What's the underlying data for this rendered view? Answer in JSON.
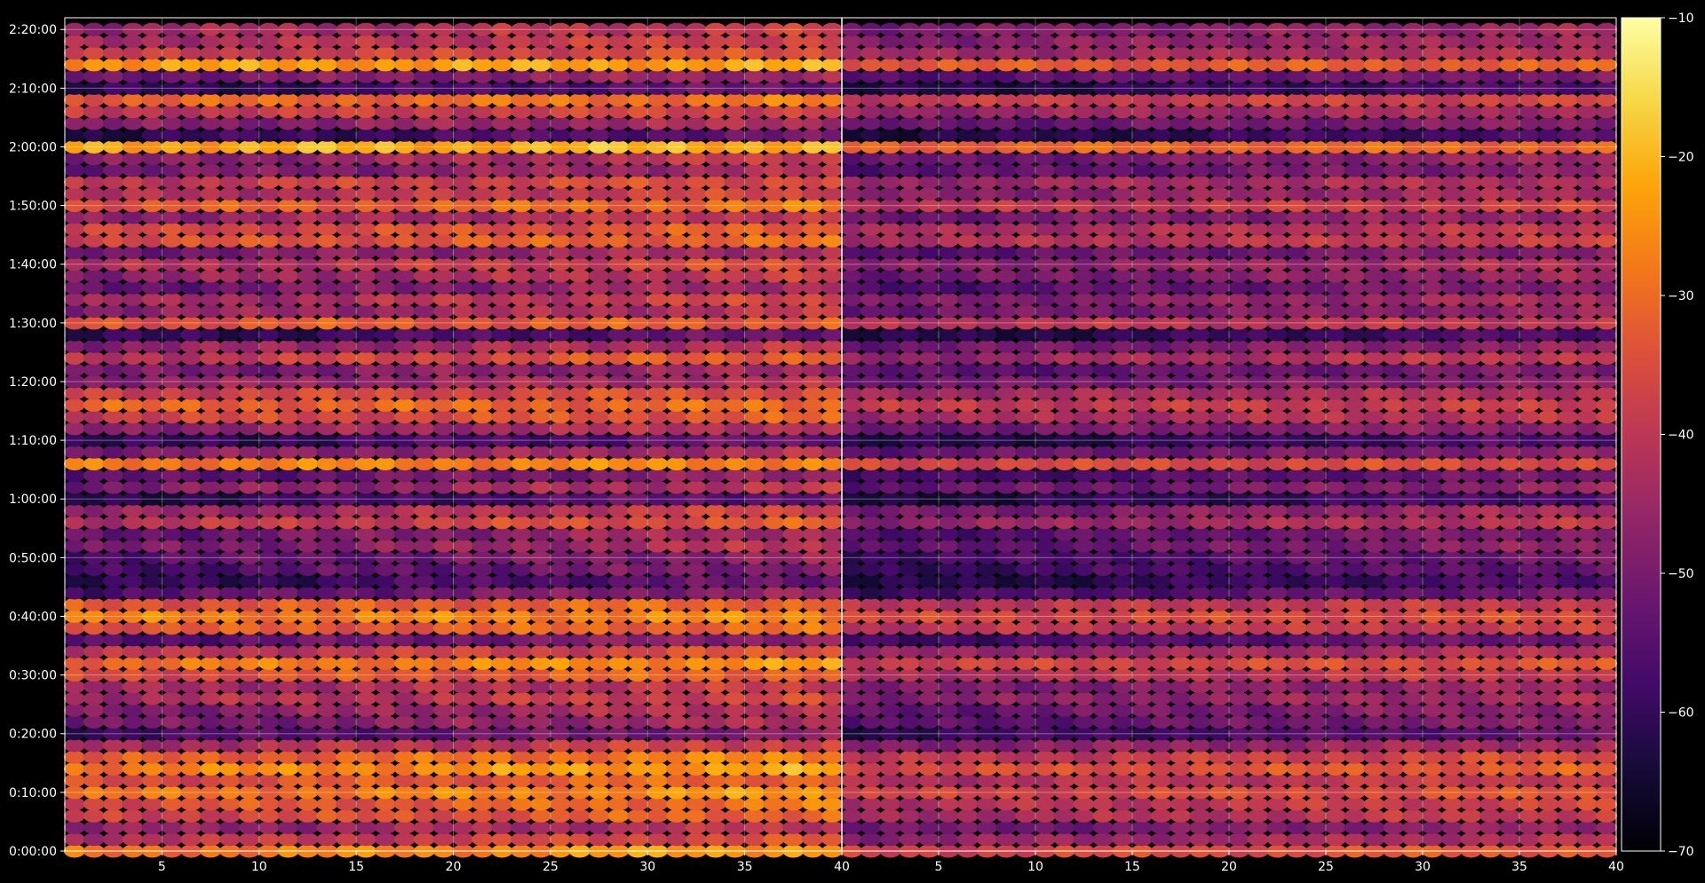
{
  "chart_data": {
    "type": "heatmap",
    "title": "",
    "xlabel": "",
    "ylabel": "",
    "colormap": "inferno",
    "background_color": "#000000",
    "grid": true,
    "panels": [
      {
        "name": "",
        "xlim": [
          1,
          40
        ],
        "x_ticks": [
          "5",
          "10",
          "15",
          "20",
          "25",
          "30",
          "35",
          "40"
        ],
        "intensity_scale": 1.0
      },
      {
        "name": "",
        "xlim": [
          1,
          40
        ],
        "x_ticks": [
          "5",
          "10",
          "15",
          "20",
          "25",
          "30",
          "35",
          "40"
        ],
        "intensity_scale": 0.8
      }
    ],
    "ylim_seconds": [
      0,
      8520
    ],
    "y_ticks": [
      "0:00:00",
      "0:10:00",
      "0:20:00",
      "0:30:00",
      "0:40:00",
      "0:50:00",
      "1:00:00",
      "1:10:00",
      "1:20:00",
      "1:30:00",
      "1:40:00",
      "1:50:00",
      "2:00:00",
      "2:10:00",
      "2:20:00"
    ],
    "colorbar": {
      "range": [
        -70,
        -10
      ],
      "ticks": [
        "-10",
        "-20",
        "-30",
        "-40",
        "-50",
        "-60",
        "-70"
      ]
    },
    "row_times": [
      "0:00:00",
      "0:02:00",
      "0:04:00",
      "0:06:00",
      "0:08:00",
      "0:10:00",
      "0:12:00",
      "0:14:00",
      "0:16:00",
      "0:18:00",
      "0:20:00",
      "0:22:00",
      "0:24:00",
      "0:26:00",
      "0:28:00",
      "0:30:00",
      "0:32:00",
      "0:34:00",
      "0:36:00",
      "0:38:00",
      "0:40:00",
      "0:42:00",
      "0:44:00",
      "0:46:00",
      "0:48:00",
      "0:50:00",
      "0:52:00",
      "0:54:00",
      "0:56:00",
      "0:58:00",
      "1:00:00",
      "1:02:00",
      "1:04:00",
      "1:06:00",
      "1:08:00",
      "1:10:00",
      "1:12:00",
      "1:14:00",
      "1:16:00",
      "1:18:00",
      "1:20:00",
      "1:22:00",
      "1:24:00",
      "1:26:00",
      "1:28:00",
      "1:30:00",
      "1:32:00",
      "1:34:00",
      "1:36:00",
      "1:38:00",
      "1:40:00",
      "1:42:00",
      "1:44:00",
      "1:46:00",
      "1:48:00",
      "1:50:00",
      "1:52:00",
      "1:54:00",
      "1:56:00",
      "1:58:00",
      "2:00:00",
      "2:02:00",
      "2:04:00",
      "2:06:00",
      "2:08:00",
      "2:10:00",
      "2:12:00",
      "2:14:00",
      "2:16:00",
      "2:18:00",
      "2:20:00"
    ],
    "row_levels_db": [
      -30,
      -42,
      -48,
      -38,
      -36,
      -30,
      -36,
      -28,
      -34,
      -44,
      -58,
      -52,
      -50,
      -44,
      -46,
      -36,
      -30,
      -42,
      -56,
      -34,
      -28,
      -34,
      -56,
      -62,
      -58,
      -56,
      -52,
      -54,
      -42,
      -48,
      -62,
      -50,
      -56,
      -28,
      -50,
      -62,
      -48,
      -38,
      -32,
      -38,
      -48,
      -52,
      -42,
      -48,
      -62,
      -34,
      -48,
      -46,
      -54,
      -48,
      -44,
      -52,
      -36,
      -38,
      -48,
      -34,
      -44,
      -40,
      -52,
      -50,
      -22,
      -62,
      -50,
      -40,
      -32,
      -62,
      -52,
      -24,
      -40,
      -44,
      -46
    ],
    "row_slopes_db": [
      8,
      8,
      8,
      8,
      8,
      6,
      6,
      6,
      8,
      8,
      10,
      10,
      10,
      8,
      8,
      6,
      6,
      8,
      10,
      4,
      2,
      4,
      10,
      10,
      10,
      10,
      12,
      12,
      10,
      12,
      10,
      10,
      10,
      2,
      8,
      10,
      8,
      6,
      2,
      4,
      6,
      8,
      12,
      8,
      10,
      2,
      8,
      10,
      12,
      10,
      10,
      10,
      6,
      6,
      10,
      6,
      8,
      6,
      10,
      12,
      2,
      10,
      8,
      4,
      4,
      10,
      8,
      2,
      6,
      8,
      8
    ]
  }
}
